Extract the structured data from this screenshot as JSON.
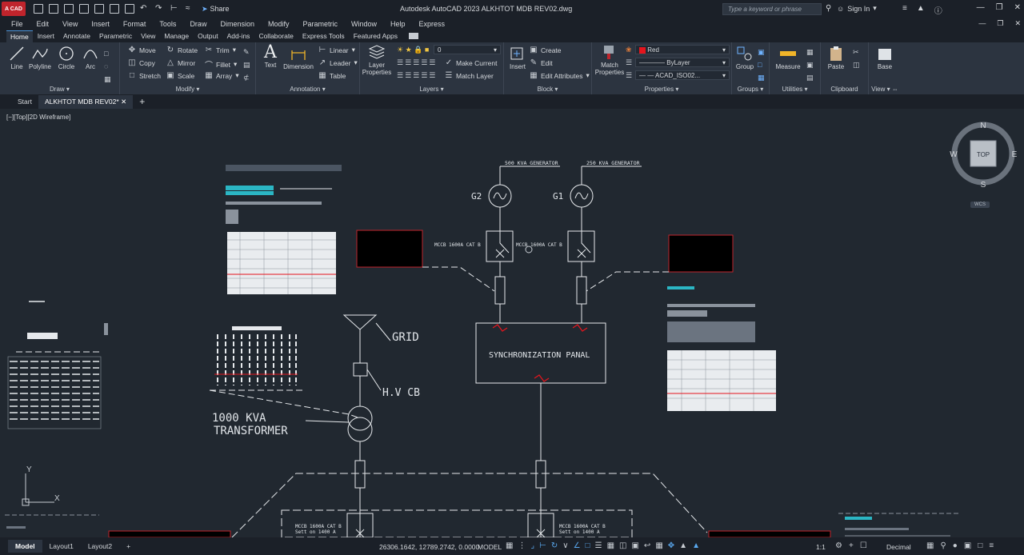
{
  "app": {
    "logo": "A CAD",
    "window_title": "Autodesk AutoCAD 2023    ALKHTOT MDB REV02.dwg",
    "share_label": "Share",
    "search_placeholder": "Type a keyword or phrase",
    "signin_label": "Sign In"
  },
  "menu": [
    "File",
    "Edit",
    "View",
    "Insert",
    "Format",
    "Tools",
    "Draw",
    "Dimension",
    "Modify",
    "Parametric",
    "Window",
    "Help",
    "Express"
  ],
  "ribbon_tabs": [
    "Home",
    "Insert",
    "Annotate",
    "Parametric",
    "View",
    "Manage",
    "Output",
    "Add-ins",
    "Collaborate",
    "Express Tools",
    "Featured Apps"
  ],
  "ribbon": {
    "draw": {
      "title": "Draw",
      "line": "Line",
      "polyline": "Polyline",
      "circle": "Circle",
      "arc": "Arc"
    },
    "modify": {
      "title": "Modify",
      "move": "Move",
      "rotate": "Rotate",
      "trim": "Trim",
      "copy": "Copy",
      "mirror": "Mirror",
      "fillet": "Fillet",
      "stretch": "Stretch",
      "scale": "Scale",
      "array": "Array"
    },
    "annotation": {
      "title": "Annotation",
      "text": "Text",
      "dimension": "Dimension",
      "linear": "Linear",
      "leader": "Leader",
      "table": "Table"
    },
    "layers": {
      "title": "Layers",
      "layer_properties_1": "Layer",
      "layer_properties_2": "Properties",
      "current_layer": "0",
      "make_current": "Make Current",
      "match_layer": "Match Layer"
    },
    "block": {
      "title": "Block",
      "insert": "Insert",
      "create": "Create",
      "edit": "Edit",
      "edit_attributes": "Edit Attributes"
    },
    "properties": {
      "title": "Properties",
      "match_1": "Match",
      "match_2": "Properties",
      "color": "Red",
      "lineweight": "ByLayer",
      "linetype": "ACAD_ISO02..."
    },
    "groups": {
      "title": "Groups",
      "group": "Group"
    },
    "utilities": {
      "title": "Utilities",
      "measure": "Measure"
    },
    "clipboard": {
      "title": "Clipboard",
      "paste": "Paste"
    },
    "view": {
      "title": "View",
      "base": "Base"
    }
  },
  "doc_tabs": {
    "start": "Start",
    "active": "ALKHTOT MDB REV02*"
  },
  "viewport_label": "[−][Top][2D Wireframe]",
  "viewcube": {
    "n": "N",
    "s": "S",
    "e": "E",
    "w": "W",
    "top": "TOP",
    "wcs": "WCS"
  },
  "drawing": {
    "gen500": "500 KVA GENERATOR",
    "gen250": "250 KVA GENERATOR",
    "g2": "G2",
    "g1": "G1",
    "mccb_left": "MCCB 1600A CAT B",
    "mccb_right": "MCCB 1600A CAT B",
    "sync_panel": "SYNCHRONIZATION PANAL",
    "grid": "GRID",
    "hv_cb": "H.V CB",
    "transformer_1": "1000 KVA",
    "transformer_2": "TRANSFORMER",
    "bottom_mccb_1": "MCCB 1600A CAT B",
    "bottom_mccb_1b": "Sett on 1400 A",
    "bottom_mccb_2": "MCCB 1600A CAT B",
    "bottom_mccb_2b": "Sett on 1400 A",
    "ucs_x": "X",
    "ucs_y": "Y"
  },
  "status": {
    "layout_tabs": [
      "Model",
      "Layout1",
      "Layout2"
    ],
    "coords": "26306.1642, 12789.2742, 0.0000",
    "model": "MODEL",
    "scale": "1:1",
    "units": "Decimal"
  }
}
